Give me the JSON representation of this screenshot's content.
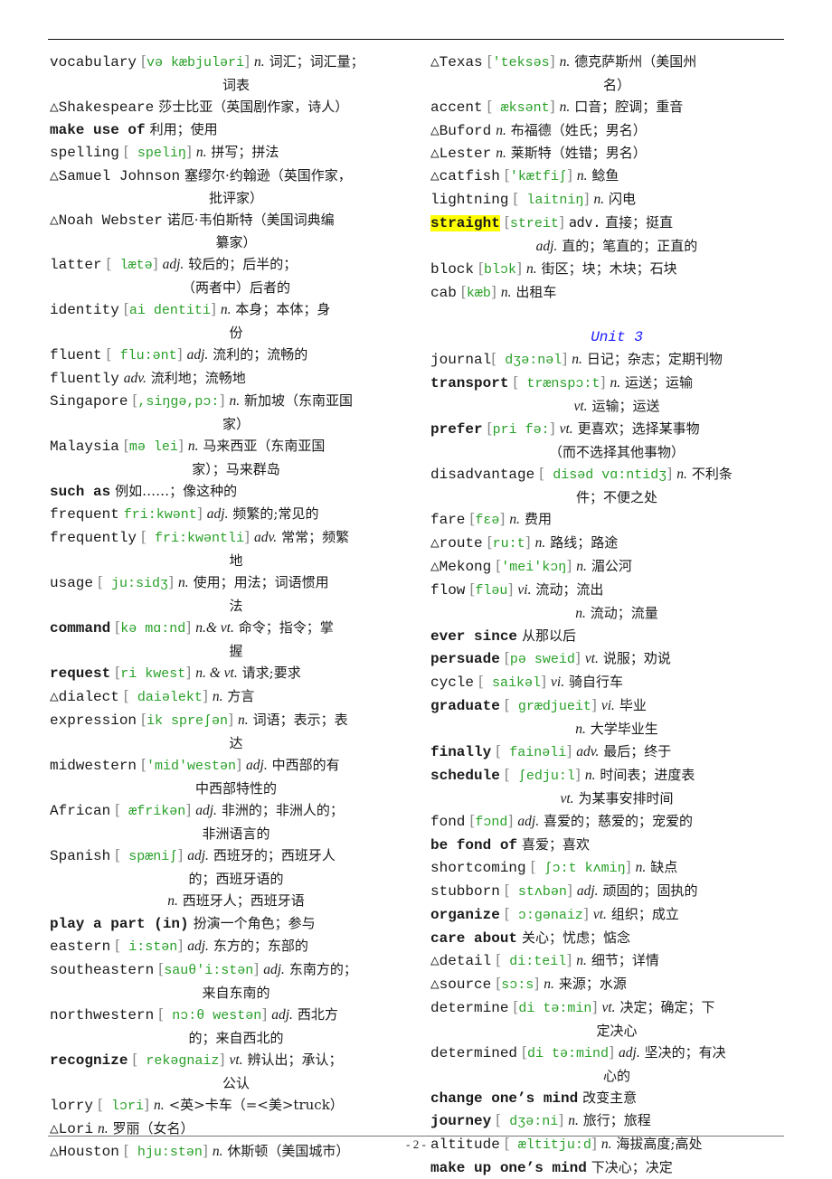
{
  "page_number": "- 2 -",
  "left_column": [
    {
      "head": "vocabulary",
      "bold": false,
      "ph": "və  kæbjuləri",
      "pos": "n.",
      "cn": "词汇；词汇量；",
      "cont": [
        "词表"
      ]
    },
    {
      "head": "△Shakespeare",
      "bold": false,
      "cn": "莎士比亚（英国剧作家，诗人）"
    },
    {
      "head": "make use of",
      "bold": true,
      "cn": "利用；使用"
    },
    {
      "head": "spelling",
      "bold": false,
      "ph": "  speliŋ",
      "pos": "n.",
      "cn": "拼写；拼法"
    },
    {
      "head": "△Samuel Johnson",
      "bold": false,
      "cn": "塞缪尔·约翰逊（英国作家，",
      "cont": [
        "批评家）"
      ]
    },
    {
      "head": "△Noah Webster",
      "bold": false,
      "cn": "诺厄·韦伯斯特（美国词典编",
      "cont": [
        "纂家）"
      ]
    },
    {
      "head": "latter",
      "bold": false,
      "ph": "  lætə",
      "pos": "adj.",
      "cn": "较后的；后半的；",
      "cont": [
        "（两者中）后者的"
      ]
    },
    {
      "head": "identity",
      "bold": false,
      "ph": "ai  dentiti",
      "pos": "n.",
      "cn": "本身；本体；身",
      "cont": [
        "份"
      ]
    },
    {
      "head": "fluent",
      "bold": false,
      "ph": "  flu:ənt",
      "pos": "adj.",
      "cn": "流利的；流畅的"
    },
    {
      "head": "fluently",
      "bold": false,
      "pos": "adv.",
      "cn": "流利地；流畅地"
    },
    {
      "head": "Singapore",
      "bold": false,
      "ph": ",siŋgə,pɔ:",
      "pos": "n.",
      "cn": "新加坡（东南亚国",
      "cont": [
        "家）"
      ]
    },
    {
      "head": "Malaysia",
      "bold": false,
      "ph": "mə  lei",
      "pos": "n.",
      "cn": "马来西亚（东南亚国",
      "cont": [
        "家）；马来群岛"
      ]
    },
    {
      "head": "such as",
      "bold": true,
      "cn": "例如……；像这种的"
    },
    {
      "head": "frequent",
      "bold": false,
      "ph": "  fri:kwənt",
      "pos": "adj.",
      "cn": "频繁的;常见的",
      "no_open_bracket": true
    },
    {
      "head": "frequently",
      "bold": false,
      "ph": "  fri:kwəntli",
      "pos": "adv.",
      "cn": "常常；频繁",
      "cont": [
        "地"
      ]
    },
    {
      "head": "usage",
      "bold": false,
      "ph": "  ju:sidʒ",
      "pos": "n.",
      "cn": "使用；用法；词语惯用",
      "cont": [
        "法"
      ]
    },
    {
      "head": "command",
      "bold": true,
      "ph": "kə  mɑ:nd",
      "pos": "n.& vt.",
      "cn": "命令；指令；掌",
      "cont": [
        "握"
      ]
    },
    {
      "head": "request",
      "bold": true,
      "ph": "ri  kwest",
      "pos": "n. & vt.",
      "cn": "请求;要求"
    },
    {
      "head": "△dialect",
      "bold": false,
      "ph": "  daiəlekt",
      "pos": "n.",
      "cn": "方言"
    },
    {
      "head": "expression",
      "bold": false,
      "ph": "ik  spreʃən",
      "pos": "n.",
      "cn": "词语；表示；表",
      "cont": [
        "达"
      ]
    },
    {
      "head": "midwestern",
      "bold": false,
      "ph": "'mid'westən",
      "pos": "adj.",
      "cn": "中西部的有",
      "cont": [
        "中西部特性的"
      ]
    },
    {
      "head": "African",
      "bold": false,
      "ph": "  æfrikən",
      "pos": "adj.",
      "cn": "非洲的；非洲人的；",
      "cont": [
        "非洲语言的"
      ]
    },
    {
      "head": "Spanish",
      "bold": false,
      "ph": "  spæniʃ",
      "pos": "adj.",
      "cn": "西班牙的；西班牙人",
      "cont": [
        "的；西班牙语的"
      ],
      "extra": {
        "pos": "n.",
        "cn": "西班牙人；西班牙语"
      }
    },
    {
      "head": "play a part (in)",
      "bold": true,
      "cn": "扮演一个角色；参与"
    },
    {
      "head": "eastern",
      "bold": false,
      "ph": "  i:stən",
      "pos": "adj.",
      "cn": "东方的；东部的"
    },
    {
      "head": "southeastern",
      "bold": false,
      "ph": "sauθ'i:stən",
      "pos": "adj.",
      "cn": "东南方的；",
      "cont": [
        "来自东南的"
      ]
    },
    {
      "head": "northwestern",
      "bold": false,
      "ph": "  nɔ:θ  westən",
      "pos": "adj.",
      "cn": "西北方",
      "cont": [
        "的；来自西北的"
      ]
    },
    {
      "head": "recognize",
      "bold": true,
      "ph": "  rekəgnaiz",
      "pos": "vt.",
      "cn": "辨认出；承认；",
      "cont": [
        "公认"
      ]
    },
    {
      "head": "lorry",
      "bold": false,
      "ph": "  lɔri",
      "pos": "n.",
      "cn": "<英>卡车（=<美>truck）"
    },
    {
      "head": "△Lori",
      "bold": false,
      "pos": "n.",
      "cn": "罗丽（女名）"
    },
    {
      "head": "△Houston",
      "bold": false,
      "ph": "  hju:stən",
      "pos": "n.",
      "cn": "休斯顿（美国城市）"
    }
  ],
  "right_column": [
    {
      "head": "△Texas",
      "bold": false,
      "ph": "'teksəs",
      "pos": "n.",
      "cn": "德克萨斯州（美国州",
      "cont": [
        "名）"
      ]
    },
    {
      "head": "accent",
      "bold": false,
      "ph": "  æksənt",
      "pos": "n.",
      "cn": "口音；腔调；重音"
    },
    {
      "head": "△Buford",
      "bold": false,
      "pos": "n.",
      "cn": "布福德（姓氏；男名）"
    },
    {
      "head": "△Lester",
      "bold": false,
      "pos": "n.",
      "cn": "莱斯特（姓错；男名）"
    },
    {
      "head": "△catfish",
      "bold": false,
      "ph": "'kætfiʃ",
      "pos": "n.",
      "cn": "鲶鱼"
    },
    {
      "head": "lightning",
      "bold": false,
      "ph": "  laitniŋ",
      "pos": "n.",
      "cn": "闪电"
    },
    {
      "head": "straight",
      "bold": true,
      "highlight": true,
      "ph": "streit",
      "pos_plain": "adv.",
      "cn": "直接；挺直",
      "extra": {
        "pos": "adj.",
        "cn": "直的；笔直的；正直的"
      }
    },
    {
      "head": "block",
      "bold": false,
      "ph": "blɔk",
      "pos": "n.",
      "cn": "街区；块；木块；石块"
    },
    {
      "head": "cab",
      "bold": false,
      "ph": "kæb",
      "pos": "n.",
      "cn": "出租车"
    },
    {
      "blank": true
    },
    {
      "unit": "Unit 3"
    },
    {
      "head": "journal",
      "bold": false,
      "ph": "  dʒə:nəl",
      "pos": "n.",
      "cn": "日记；杂志；定期刊物",
      "tight": true
    },
    {
      "head": "transport",
      "bold": true,
      "ph": "  trænspɔ:t",
      "pos": "n.",
      "cn": "运送；运输",
      "extra": {
        "pos": "vt.",
        "cn": "运输；运送"
      }
    },
    {
      "head": "prefer",
      "bold": true,
      "ph": "pri  fə:",
      "pos": "vt.",
      "cn": "更喜欢；选择某事物",
      "cont": [
        "（而不选择其他事物）"
      ]
    },
    {
      "head": "disadvantage",
      "bold": false,
      "ph": "  disəd  vɑ:ntidʒ",
      "pos": "n.",
      "cn": "不利条",
      "cont": [
        "件；不便之处"
      ]
    },
    {
      "head": "fare",
      "bold": false,
      "ph": "fɛə",
      "pos": "n.",
      "cn": "费用"
    },
    {
      "head": "△route",
      "bold": false,
      "ph": "ru:t",
      "pos": "n.",
      "cn": "路线；路途"
    },
    {
      "head": "△Mekong",
      "bold": false,
      "ph": "'mei'kɔŋ",
      "pos": "n.",
      "cn": "湄公河"
    },
    {
      "head": "flow",
      "bold": false,
      "ph": "fləu",
      "pos": "vi.",
      "cn": "流动；流出",
      "extra": {
        "pos": "n.",
        "cn": "流动；流量"
      }
    },
    {
      "head": "ever since",
      "bold": true,
      "cn": "从那以后"
    },
    {
      "head": "persuade",
      "bold": true,
      "ph": "pə  sweid",
      "pos": "vt.",
      "cn": "说服；劝说"
    },
    {
      "head": "cycle",
      "bold": false,
      "ph": "  saikəl",
      "pos": "vi.",
      "cn": "骑自行车"
    },
    {
      "head": "graduate",
      "bold": true,
      "ph": "  grædjueit",
      "pos": "vi.",
      "cn": "毕业",
      "extra": {
        "pos": "n.",
        "cn": "大学毕业生"
      }
    },
    {
      "head": "finally",
      "bold": true,
      "ph": "  fainəli",
      "pos": "adv.",
      "cn": "最后；终于"
    },
    {
      "head": "schedule",
      "bold": true,
      "ph": "  ʃedju:l",
      "pos": "n.",
      "cn": "时间表；进度表",
      "extra": {
        "pos": "vt.",
        "cn": "为某事安排时间"
      }
    },
    {
      "head": "fond",
      "bold": false,
      "ph": "fɔnd",
      "pos": "adj.",
      "cn": "喜爱的；慈爱的；宠爱的"
    },
    {
      "head": "be fond of",
      "bold": true,
      "cn": "喜爱；喜欢"
    },
    {
      "head": "shortcoming",
      "bold": false,
      "ph": "  ʃɔ:t  kʌmiŋ",
      "pos": "n.",
      "cn": "缺点"
    },
    {
      "head": "stubborn",
      "bold": false,
      "ph": "  stʌbən",
      "pos": "adj.",
      "cn": "顽固的；固执的"
    },
    {
      "head": "organize",
      "bold": true,
      "ph": "  ɔ:gənaiz",
      "pos": "vt.",
      "cn": "组织；成立"
    },
    {
      "head": "care about",
      "bold": true,
      "cn": "关心；忧虑；惦念"
    },
    {
      "head": "△detail",
      "bold": false,
      "ph": "  di:teil",
      "pos": "n.",
      "cn": "细节；详情"
    },
    {
      "head": "△source",
      "bold": false,
      "ph": "sɔ:s",
      "pos": "n.",
      "cn": "来源；水源"
    },
    {
      "head": "determine",
      "bold": false,
      "ph": "di  tə:min",
      "pos": "vt.",
      "cn": "决定；确定；下",
      "cont": [
        "定决心"
      ]
    },
    {
      "head": "determined",
      "bold": false,
      "ph": "di  tə:mind",
      "pos": "adj.",
      "cn": "坚决的；有决",
      "cont": [
        "心的"
      ]
    },
    {
      "head": "change one’s mind",
      "bold": true,
      "cn": "改变主意"
    },
    {
      "head": "journey",
      "bold": true,
      "ph": "  dʒə:ni",
      "pos": "n.",
      "cn": "旅行；旅程"
    },
    {
      "head": "altitude",
      "bold": false,
      "ph": "  æltitju:d",
      "pos": "n.",
      "cn": "海拔高度;高处"
    },
    {
      "head": "make up one’s mind",
      "bold": true,
      "cn": "下决心；决定"
    }
  ]
}
